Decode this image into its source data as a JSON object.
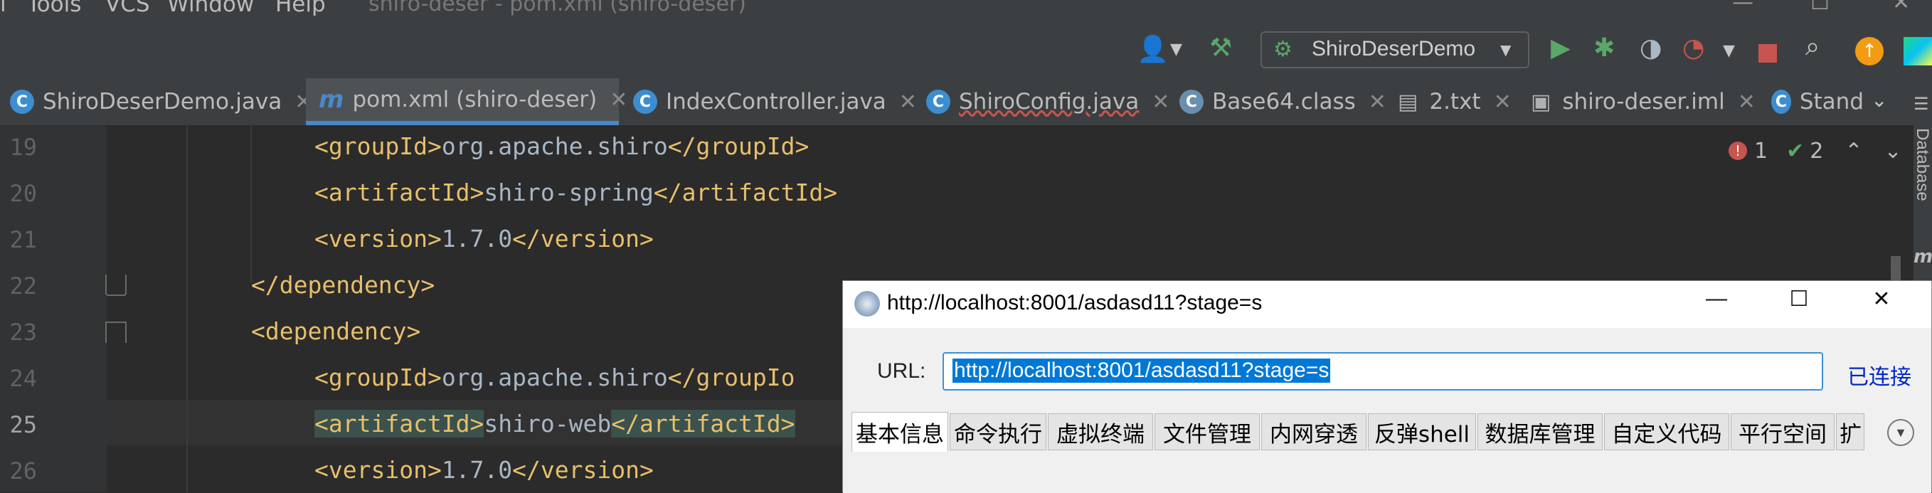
{
  "menubar": {
    "items": [
      "Tools",
      "VCS",
      "Window",
      "Help"
    ],
    "title": "shiro-deser - pom.xml (shiro-deser)"
  },
  "toolbar": {
    "run_config": "ShiroDeserDemo"
  },
  "tabs": [
    {
      "label": "ShiroDeserDemo.java",
      "icon": "java-class-icon"
    },
    {
      "label": "pom.xml (shiro-deser)",
      "icon": "maven-icon",
      "active": true
    },
    {
      "label": "IndexController.java",
      "icon": "java-class-icon"
    },
    {
      "label": "ShiroConfig.java",
      "icon": "java-class-icon"
    },
    {
      "label": "Base64.class",
      "icon": "class-file-icon"
    },
    {
      "label": "2.txt",
      "icon": "text-file-icon"
    },
    {
      "label": "shiro-deser.iml",
      "icon": "module-file-icon"
    },
    {
      "label": "Stand",
      "icon": "java-class-icon"
    }
  ],
  "inspections": {
    "errors": "1",
    "warnings": "2"
  },
  "sidebar": {
    "database_label": "Database"
  },
  "editor": {
    "lines": [
      {
        "num": "19",
        "open": "<groupId>",
        "text": "org.apache.shiro",
        "close": "</groupId>"
      },
      {
        "num": "20",
        "open": "<artifactId>",
        "text": "shiro-spring",
        "close": "</artifactId>"
      },
      {
        "num": "21",
        "open": "<version>",
        "text": "1.7.0",
        "close": "</version>"
      },
      {
        "num": "22",
        "open": "</dependency>",
        "text": "",
        "close": ""
      },
      {
        "num": "23",
        "open": "<dependency>",
        "text": "",
        "close": ""
      },
      {
        "num": "24",
        "open": "<groupId>",
        "text": "org.apache.shiro",
        "close": "</groupIo"
      },
      {
        "num": "25",
        "open": "<artifactId>",
        "text": "shiro-web",
        "close": "</artifactId>"
      },
      {
        "num": "26",
        "open": "<version>",
        "text": "1.7.0",
        "close": "</version>"
      }
    ]
  },
  "dialog": {
    "title": "http://localhost:8001/asdasd11?stage=s",
    "url_label": "URL:",
    "url_value": "http://localhost:8001/asdasd11?stage=s",
    "status": "已连接",
    "tabs": [
      "基本信息",
      "命令执行",
      "虚拟终端",
      "文件管理",
      "内网穿透",
      "反弹shell",
      "数据库管理",
      "自定义代码",
      "平行空间",
      "扩"
    ]
  },
  "colors": {
    "editor_bg": "#2b2b2b",
    "tag": "#e8bf6a",
    "text": "#a9b7c6",
    "selection": "#3c8fd8",
    "link_blue": "#0026c8"
  }
}
